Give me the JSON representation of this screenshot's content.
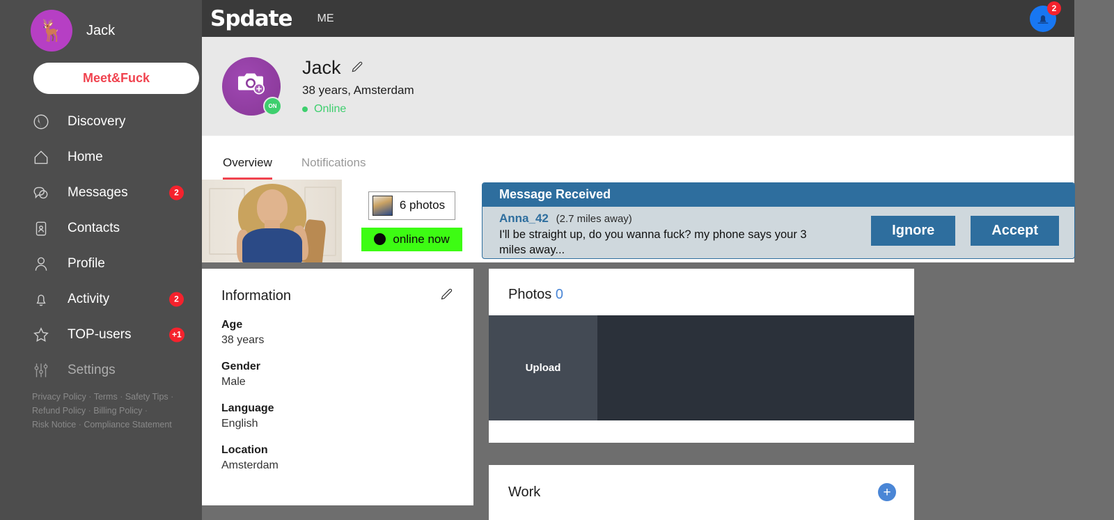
{
  "sidebar": {
    "user_name": "Jack",
    "cta_label": "Meet&Fuck",
    "items": [
      {
        "label": "Discovery",
        "icon": "globe-icon",
        "badge": ""
      },
      {
        "label": "Home",
        "icon": "home-icon",
        "badge": ""
      },
      {
        "label": "Messages",
        "icon": "chat-icon",
        "badge": "2"
      },
      {
        "label": "Contacts",
        "icon": "contact-card-icon",
        "badge": ""
      },
      {
        "label": "Profile",
        "icon": "person-icon",
        "badge": ""
      },
      {
        "label": "Activity",
        "icon": "bell-icon",
        "badge": "2"
      },
      {
        "label": "TOP-users",
        "icon": "star-icon",
        "badge": "+1"
      },
      {
        "label": "Settings",
        "icon": "sliders-icon",
        "badge": ""
      }
    ],
    "footer_links": [
      "Privacy Policy",
      "Terms",
      "Safety Tips",
      "Refund Policy",
      "Billing Policy",
      "Risk Notice",
      "Compliance Statement"
    ]
  },
  "topbar": {
    "logo": "Spdate",
    "me_label": "ME",
    "bell_icon": "bell-icon",
    "bell_badge": "2"
  },
  "profile": {
    "avatar_icon": "camera-add-icon",
    "online_badge": "ON",
    "name": "Jack",
    "edit_icon": "pencil-icon",
    "details": "38 years, Amsterdam",
    "status": "Online"
  },
  "tabs": [
    {
      "label": "Overview",
      "active": true
    },
    {
      "label": "Notifications",
      "active": false
    }
  ],
  "ad": {
    "photo_alt": "blonde-woman-photo",
    "photos_pill": "6 photos",
    "online_pill": "online now",
    "banner": {
      "header": "Message Received",
      "username": "Anna_42",
      "distance": "(2.7 miles away)",
      "message": "I'll be straight up, do you wanna fuck?  my phone says your 3 miles away...",
      "ignore_label": "Ignore",
      "accept_label": "Accept"
    }
  },
  "information": {
    "title": "Information",
    "edit_icon": "pencil-icon",
    "fields": [
      {
        "key": "Age",
        "value": "38 years"
      },
      {
        "key": "Gender",
        "value": "Male"
      },
      {
        "key": "Language",
        "value": "English"
      },
      {
        "key": "Location",
        "value": "Amsterdam"
      }
    ]
  },
  "photos": {
    "title": "Photos",
    "count": "0",
    "upload_label": "Upload"
  },
  "work": {
    "title": "Work",
    "add_icon": "plus-icon"
  },
  "colors": {
    "accent_red": "#f0434f",
    "banner_blue": "#2e6e9e",
    "badge_red": "#f5222d",
    "online_green": "#3ecf6e",
    "pill_green": "#3dfc13",
    "link_blue": "#4a86d6",
    "avatar_purple": "#8e3c9e"
  }
}
